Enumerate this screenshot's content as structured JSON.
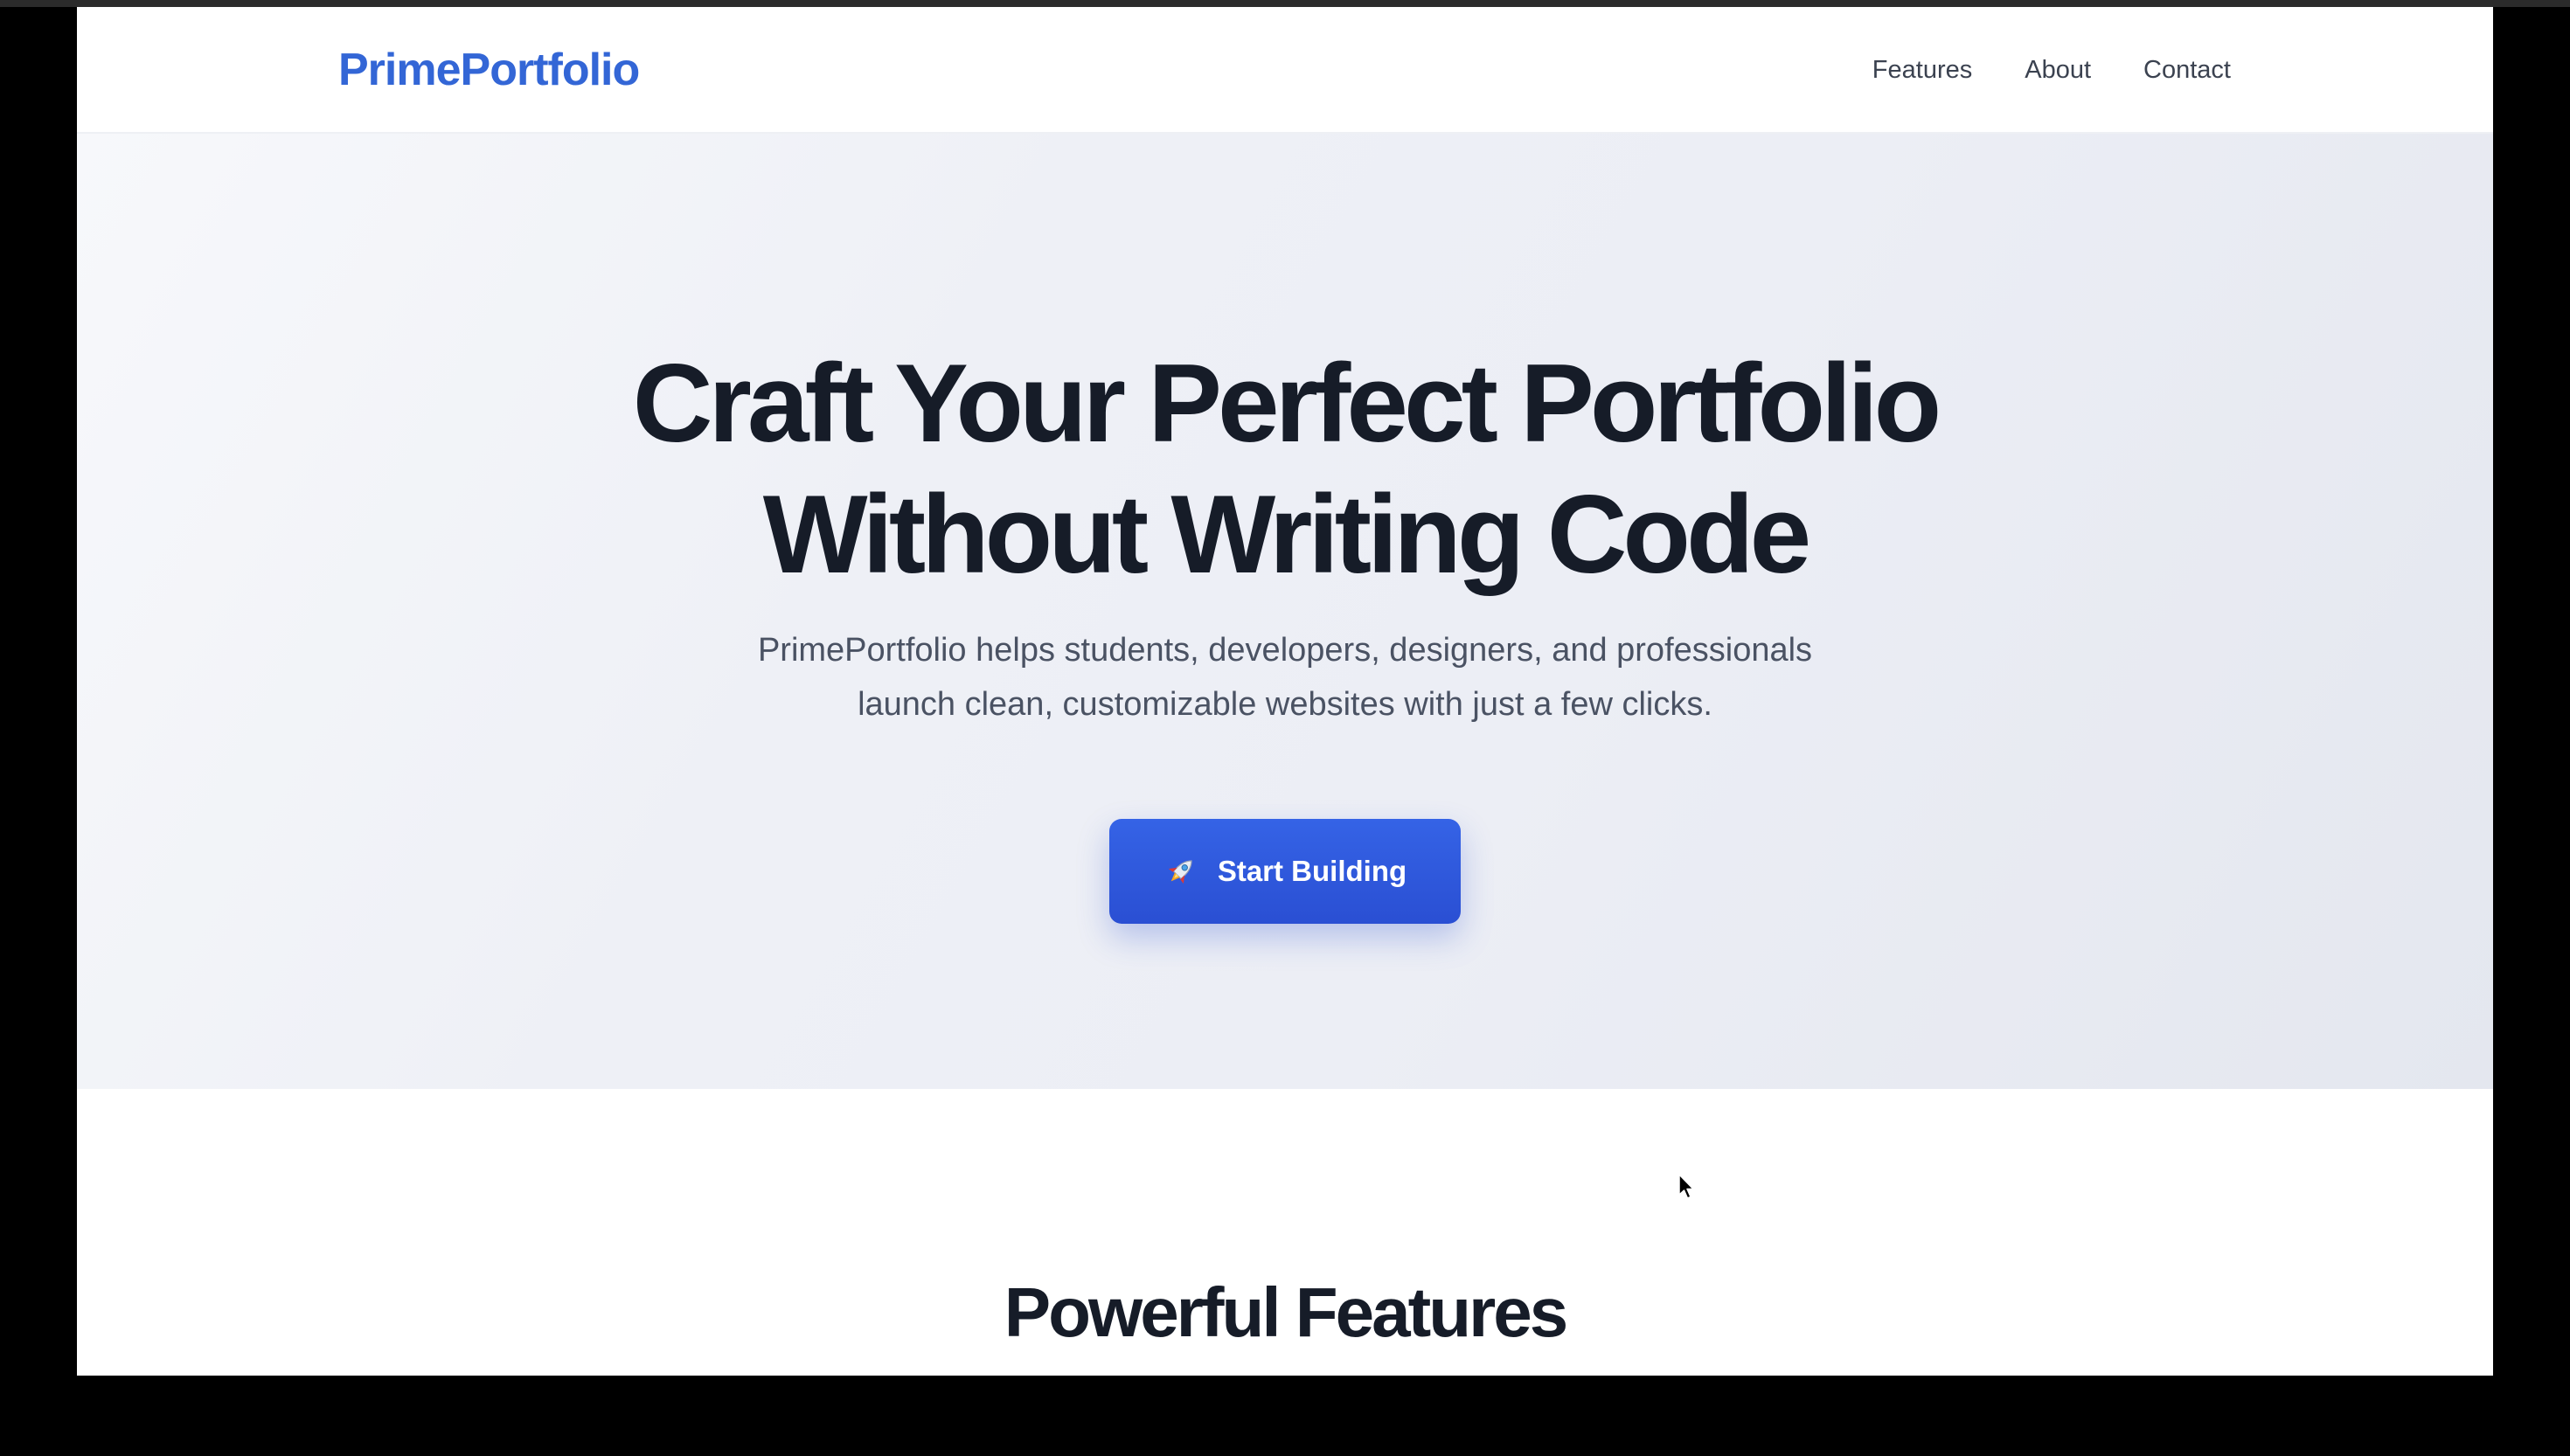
{
  "header": {
    "brand": "PrimePortfolio",
    "nav": [
      "Features",
      "About",
      "Contact"
    ]
  },
  "hero": {
    "title_line1": "Craft Your Perfect Portfolio",
    "title_line2": "Without Writing Code",
    "subtitle_line1": "PrimePortfolio helps students, developers, designers, and professionals",
    "subtitle_line2": "launch clean, customizable websites with just a few clicks.",
    "cta_label": "Start Building",
    "cta_icon": "rocket-icon"
  },
  "features": {
    "title": "Powerful Features"
  },
  "colors": {
    "brand": "#3366d6",
    "cta": "#2f5be0",
    "heading": "#161c28",
    "body_text": "#4a5263"
  }
}
